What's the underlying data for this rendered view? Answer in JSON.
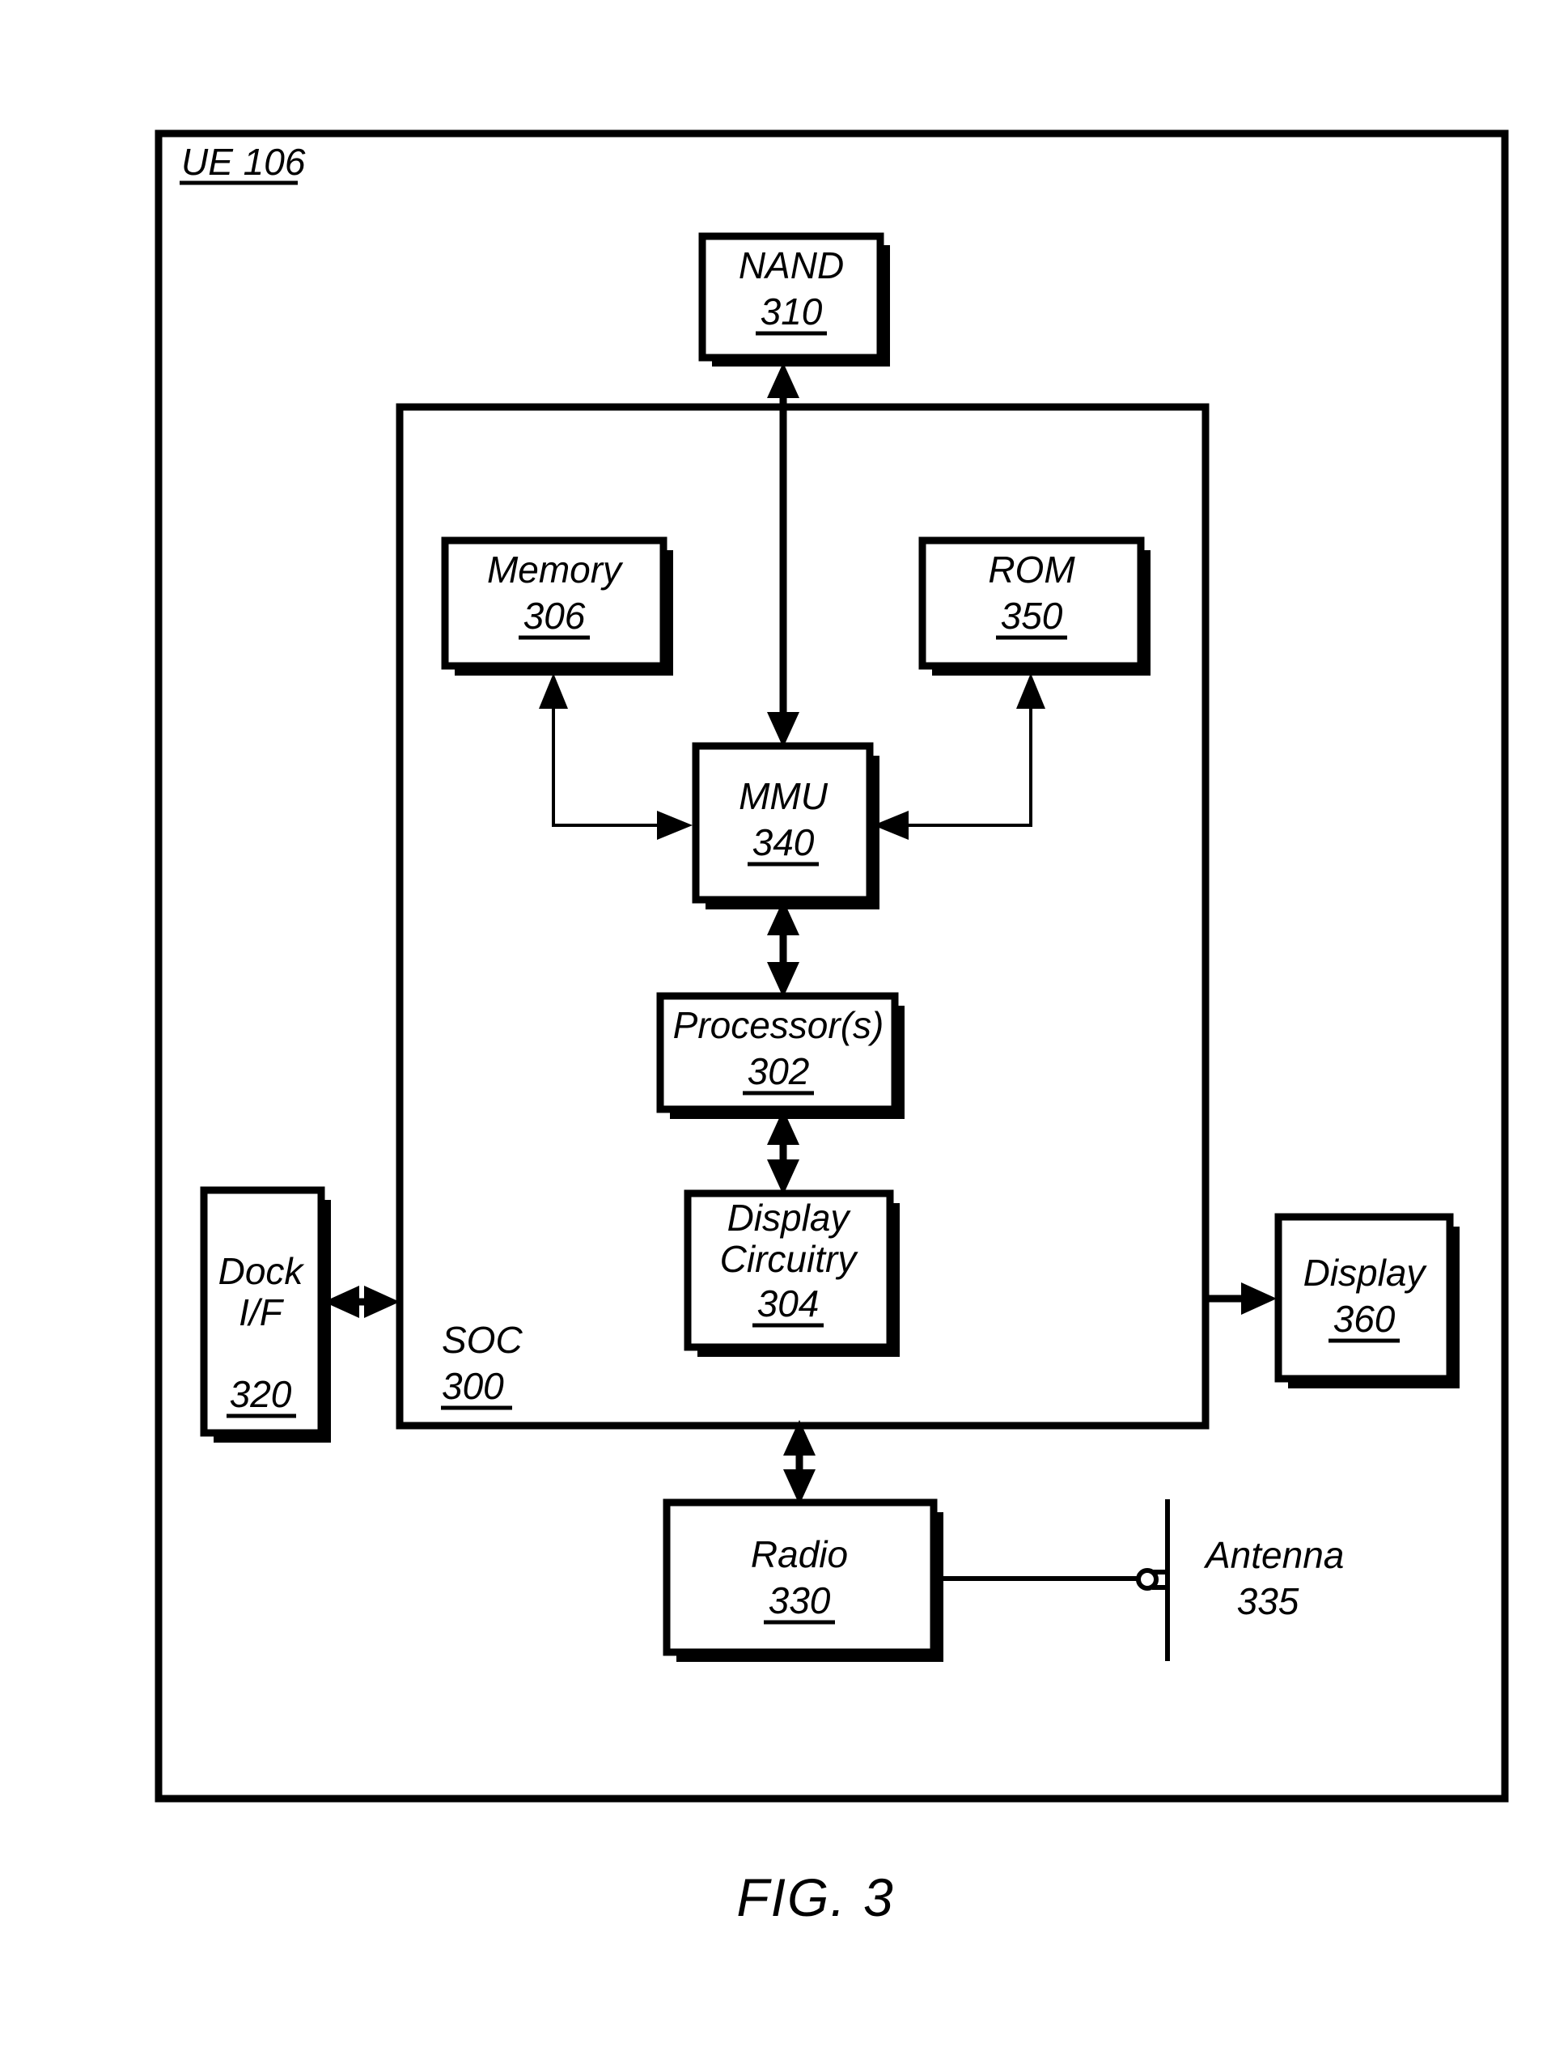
{
  "figure": {
    "caption": "FIG. 3",
    "outer_label": "UE 106",
    "outer_label_name": "UE",
    "outer_label_ref": "106"
  },
  "colors": {
    "stroke": "#000000",
    "background": "#ffffff",
    "shadow": "#000000"
  },
  "blocks": {
    "nand": {
      "name": "NAND",
      "ref": "310",
      "ref_underlined": true
    },
    "memory": {
      "name": "Memory",
      "ref": "306",
      "ref_underlined": true
    },
    "rom": {
      "name": "ROM",
      "ref": "350",
      "ref_underlined": true
    },
    "mmu": {
      "name": "MMU",
      "ref": "340",
      "ref_underlined": true
    },
    "processor": {
      "name": "Processor(s)",
      "ref": "302",
      "ref_underlined": true
    },
    "display_circuitry": {
      "name_line1": "Display",
      "name_line2": "Circuitry",
      "ref": "304",
      "ref_underlined": true
    },
    "soc": {
      "name": "SOC",
      "ref": "300",
      "ref_underlined": true
    },
    "dock": {
      "name_line1": "Dock",
      "name_line2": "I/F",
      "ref": "320",
      "ref_underlined": true
    },
    "display": {
      "name": "Display",
      "ref": "360",
      "ref_underlined": true
    },
    "radio": {
      "name": "Radio",
      "ref": "330",
      "ref_underlined": true
    },
    "antenna": {
      "name": "Antenna",
      "ref": "335",
      "ref_underlined": false
    }
  },
  "connections": [
    {
      "from": "nand",
      "to": "mmu",
      "type": "double-arrow",
      "orientation": "vertical"
    },
    {
      "from": "memory",
      "to": "mmu",
      "type": "elbow-double",
      "orientation": "left"
    },
    {
      "from": "rom",
      "to": "mmu",
      "type": "elbow-double",
      "orientation": "right"
    },
    {
      "from": "mmu",
      "to": "processor",
      "type": "double-arrow",
      "orientation": "vertical"
    },
    {
      "from": "processor",
      "to": "display_circuitry",
      "type": "double-arrow",
      "orientation": "vertical"
    },
    {
      "from": "dock",
      "to": "soc",
      "type": "double-arrow",
      "orientation": "horizontal"
    },
    {
      "from": "soc",
      "to": "display",
      "type": "single-arrow",
      "orientation": "horizontal"
    },
    {
      "from": "soc",
      "to": "radio",
      "type": "double-arrow",
      "orientation": "vertical"
    },
    {
      "from": "radio",
      "to": "antenna",
      "type": "plain-line",
      "orientation": "horizontal"
    }
  ]
}
